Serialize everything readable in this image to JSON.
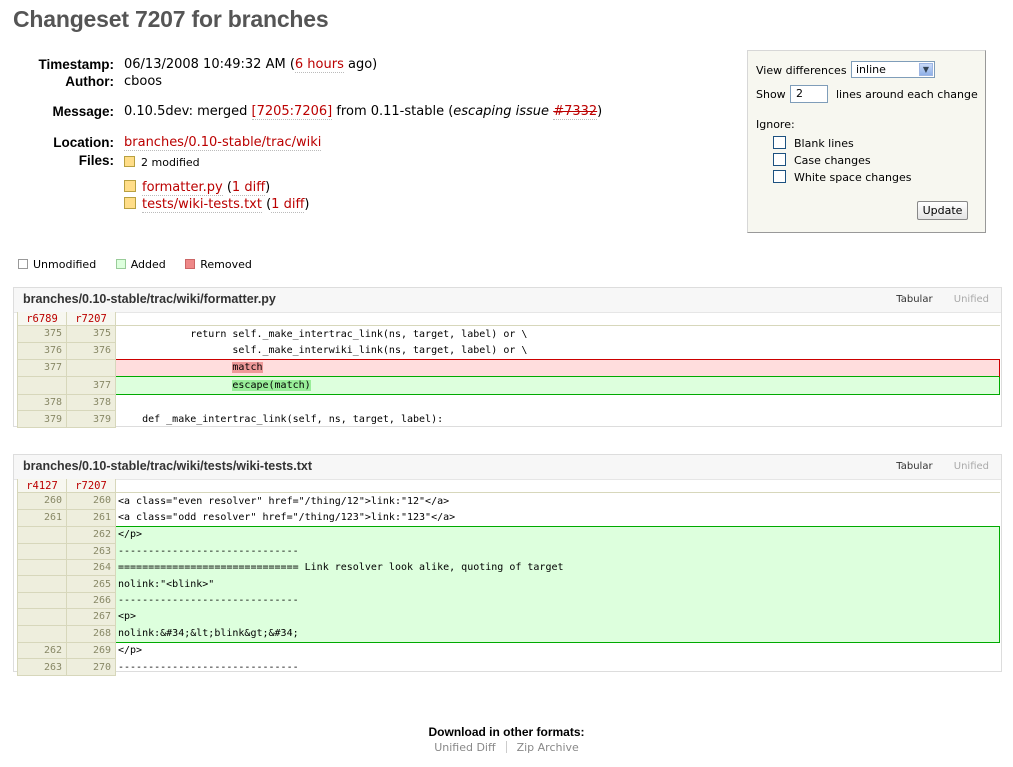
{
  "title": "Changeset 7207 for branches",
  "props": {
    "timestamp_label": "Timestamp:",
    "timestamp_value": "06/13/2008 10:49:32 AM (",
    "timestamp_rel": "6 hours",
    "timestamp_tail": " ago)",
    "author_label": "Author:",
    "author_value": "cboos",
    "message_label": "Message:",
    "message_pre": "0.10.5dev: merged ",
    "message_link": "[7205:7206]",
    "message_mid": " from 0.11-stable (",
    "message_italic": "escaping issue ",
    "message_ticket": "#7332",
    "message_close": ")",
    "location_label": "Location:",
    "location_value": "branches/0.10-stable/trac/wiki",
    "files_label": "Files:",
    "files_summary": "2 modified",
    "files": [
      {
        "name": "formatter.py",
        "diff": "1 diff"
      },
      {
        "name": "tests/wiki-tests.txt",
        "diff": "1 diff"
      }
    ]
  },
  "prefs": {
    "view_label": "View differences",
    "view_value": "inline",
    "show_label": "Show",
    "show_value": "2",
    "show_suffix": "lines around each change",
    "ignore_label": "Ignore:",
    "options": [
      "Blank lines",
      "Case changes",
      "White space changes"
    ],
    "update_label": "Update"
  },
  "legend": {
    "unmodified": "Unmodified",
    "added": "Added",
    "removed": "Removed",
    "colors": {
      "unmodified": "#ffffff",
      "added": "#ddffdd",
      "removed": "#ee8888"
    }
  },
  "diffs": [
    {
      "file": "branches/0.10-stable/trac/wiki/formatter.py",
      "tab_tabular": "Tabular",
      "tab_unified": "Unified",
      "old_rev": "r6789",
      "new_rev": "r7207",
      "lines": [
        {
          "type": "ctx",
          "old": "375",
          "new": "375",
          "text": "            return self._make_intertrac_link(ns, target, label) or \\"
        },
        {
          "type": "ctx",
          "old": "376",
          "new": "376",
          "text": "                   self._make_interwiki_link(ns, target, label) or \\"
        },
        {
          "type": "rem",
          "old": "377",
          "new": "",
          "pre": "                   ",
          "hl": "match",
          "post": ""
        },
        {
          "type": "add",
          "old": "",
          "new": "377",
          "pre": "                   ",
          "hl": "escape(match)",
          "post": ""
        },
        {
          "type": "ctx",
          "old": "378",
          "new": "378",
          "text": ""
        },
        {
          "type": "ctx",
          "old": "379",
          "new": "379",
          "text": "    def _make_intertrac_link(self, ns, target, label):"
        }
      ]
    },
    {
      "file": "branches/0.10-stable/trac/wiki/tests/wiki-tests.txt",
      "tab_tabular": "Tabular",
      "tab_unified": "Unified",
      "old_rev": "r4127",
      "new_rev": "r7207",
      "lines": [
        {
          "type": "ctx",
          "old": "260",
          "new": "260",
          "text": "<a class=\"even resolver\" href=\"/thing/12\">link:\"12\"</a>"
        },
        {
          "type": "ctx",
          "old": "261",
          "new": "261",
          "text": "<a class=\"odd resolver\" href=\"/thing/123\">link:\"123\"</a>"
        },
        {
          "type": "add",
          "old": "",
          "new": "262",
          "text": "</p>"
        },
        {
          "type": "add",
          "old": "",
          "new": "263",
          "text": "------------------------------"
        },
        {
          "type": "add",
          "old": "",
          "new": "264",
          "text": "============================== Link resolver look alike, quoting of target"
        },
        {
          "type": "add",
          "old": "",
          "new": "265",
          "text": "nolink:\"<blink>\""
        },
        {
          "type": "add",
          "old": "",
          "new": "266",
          "text": "------------------------------"
        },
        {
          "type": "add",
          "old": "",
          "new": "267",
          "text": "<p>"
        },
        {
          "type": "add",
          "old": "",
          "new": "268",
          "text": "nolink:&#34;&lt;blink&gt;&#34;"
        },
        {
          "type": "ctx",
          "old": "262",
          "new": "269",
          "text": "</p>"
        },
        {
          "type": "ctx",
          "old": "263",
          "new": "270",
          "text": "------------------------------"
        }
      ]
    }
  ],
  "footer": {
    "heading": "Download in other formats:",
    "links": [
      "Unified Diff",
      "Zip Archive"
    ]
  }
}
